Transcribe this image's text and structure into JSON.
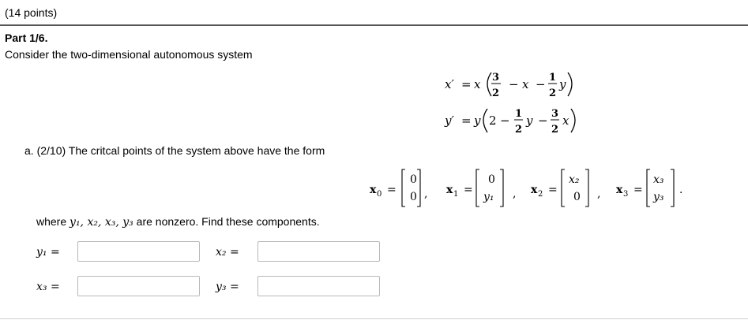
{
  "header": {
    "points": "(14 points)"
  },
  "part": {
    "title": "Part 1/6.",
    "intro": "Consider the two-dimensional autonomous system"
  },
  "system": {
    "eq1": {
      "lhs": "x′",
      "var": "x",
      "frac1_num": "3",
      "frac1_den": "2",
      "minus_x": "x",
      "frac2_num": "1",
      "frac2_den": "2",
      "y": "y"
    },
    "eq2": {
      "lhs": "y′",
      "var": "y",
      "const": "2",
      "frac1_num": "1",
      "frac1_den": "2",
      "y": "y",
      "frac2_num": "3",
      "frac2_den": "2",
      "x": "x"
    }
  },
  "question_a": {
    "text": "a. (2/10) The critcal points of the system above have the form",
    "points": [
      {
        "label": "x",
        "sub": "0",
        "top": "0",
        "bottom": "0"
      },
      {
        "label": "x",
        "sub": "1",
        "top": "0",
        "bottom": "y₁"
      },
      {
        "label": "x",
        "sub": "2",
        "top": "x₂",
        "bottom": "0"
      },
      {
        "label": "x",
        "sub": "3",
        "top": "x₃",
        "bottom": "y₃"
      }
    ]
  },
  "where": {
    "prefix": "where ",
    "vars": "y₁, x₂, x₃, y₃",
    "suffix": " are nonzero. Find these components."
  },
  "fields": [
    {
      "label": "y₁ =",
      "value": ""
    },
    {
      "label": "x₂ =",
      "value": ""
    },
    {
      "label": "x₃ =",
      "value": ""
    },
    {
      "label": "y₃ =",
      "value": ""
    }
  ]
}
